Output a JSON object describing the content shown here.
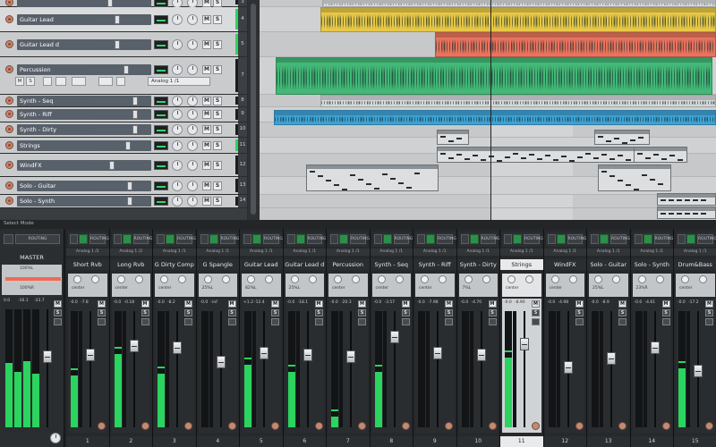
{
  "tracks": [
    {
      "name": "",
      "num": "3"
    },
    {
      "name": "Guitar Lead",
      "num": "4"
    },
    {
      "name": "Guitar Lead d",
      "num": "5"
    },
    {
      "name": "Percussion",
      "num": "7",
      "tall": true,
      "input": "Analog 1 /1"
    },
    {
      "name": "Synth - Seq",
      "num": "8"
    },
    {
      "name": "Synth - Riff",
      "num": "9"
    },
    {
      "name": "Synth - Dirty",
      "num": "10"
    },
    {
      "name": "Strings",
      "num": "11"
    },
    {
      "name": "WindFX",
      "num": "12"
    },
    {
      "name": "Solo - Guitar",
      "num": "13"
    },
    {
      "name": "Solo - Synth",
      "num": "14"
    }
  ],
  "divider_label": "Select Mode",
  "master": {
    "name": "MASTER",
    "routing": "ROUTING",
    "pan_label_1": "100%L",
    "pan_label_2": "100%R",
    "vol": "0.0",
    "peak1": "-16.1",
    "peak2": "-23.7"
  },
  "strips": [
    {
      "name": "Short Rvb",
      "num": "1",
      "pan": "center",
      "vol": "-0.0",
      "input": "Analog 1 /2",
      "peak": "-7.8"
    },
    {
      "name": "Long Rvb",
      "num": "2",
      "pan": "center",
      "vol": "-0.0",
      "input": "Analog 1 /2",
      "peak": "-0.18"
    },
    {
      "name": "G Dirty Comp",
      "num": "3",
      "pan": "center",
      "vol": "-0.0",
      "input": "Analog 1 /1",
      "peak": "-8.2"
    },
    {
      "name": "G Spangle",
      "num": "4",
      "pan": "25%L",
      "vol": "-0.0",
      "input": "Analog 1 /1",
      "peak": "-inf"
    },
    {
      "name": "Guitar Lead",
      "num": "5",
      "pan": "82%L",
      "vol": "+1.2",
      "input": "Analog 1 /1",
      "peak": "-12.4"
    },
    {
      "name": "Guitar Lead d",
      "num": "6",
      "pan": "25%L",
      "vol": "-0.0",
      "input": "Analog 1 /1",
      "peak": "-18.1"
    },
    {
      "name": "Percussion",
      "num": "7",
      "pan": "center",
      "vol": "-0.0",
      "input": "Analog 1 /1",
      "peak": "-20.3"
    },
    {
      "name": "Synth - Seq",
      "num": "8",
      "pan": "center",
      "vol": "-0.0",
      "input": "Analog 1 /1",
      "peak": "-3.57"
    },
    {
      "name": "Synth - Riff",
      "num": "9",
      "pan": "center",
      "vol": "-0.0",
      "input": "Analog 1 /1",
      "peak": "-7.98"
    },
    {
      "name": "Synth - Dirty",
      "num": "10",
      "pan": "7%L",
      "vol": "-0.0",
      "input": "Analog 1 /1",
      "peak": "-4.70"
    },
    {
      "name": "Strings",
      "num": "11",
      "pan": "center",
      "vol": "-0.0",
      "input": "Analog 1 /1",
      "peak": "-8.90",
      "selected": true
    },
    {
      "name": "WindFX",
      "num": "12",
      "pan": "center",
      "vol": "-0.0",
      "input": "Analog 1 /1",
      "peak": "-4.98"
    },
    {
      "name": "Solo - Guitar",
      "num": "13",
      "pan": "25%L",
      "vol": "-0.0",
      "input": "Analog 1 /1",
      "peak": "-8.9"
    },
    {
      "name": "Solo - Synth",
      "num": "14",
      "pan": "23%R",
      "vol": "-0.0",
      "input": "Analog 1 /1",
      "peak": "-4.61"
    },
    {
      "name": "Drum&Bass",
      "num": "15",
      "pan": "center",
      "vol": "-0.0",
      "input": "Analog 1 /1",
      "peak": "-17.2"
    }
  ],
  "routing_label": "ROUTING",
  "colors": {
    "accent_green": "#2bd35f",
    "item_yellow": "#e7c847",
    "item_red": "#e8735e",
    "item_green": "#43b877",
    "item_blue": "#3ea3d6"
  }
}
